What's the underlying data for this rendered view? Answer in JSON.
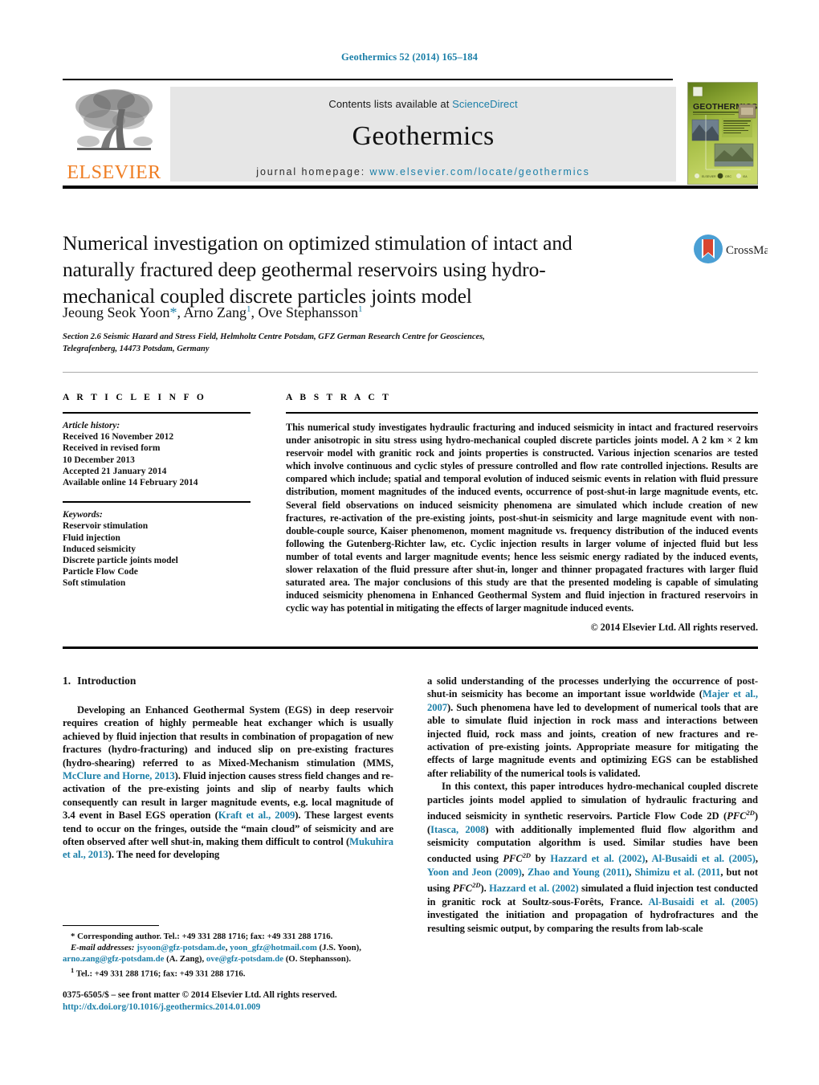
{
  "running_head": "Geothermics 52 (2014) 165–184",
  "masthead": {
    "contents_prefix": "Contents lists available at ",
    "contents_link": "ScienceDirect",
    "journal_name": "Geothermics",
    "homepage_label": "journal homepage:",
    "homepage_url": "www.elsevier.com/locate/geothermics",
    "publisher": "ELSEVIER",
    "cover_title": "GEOTHERMICS"
  },
  "article": {
    "title": "Numerical investigation on optimized stimulation of intact and naturally fractured deep geothermal reservoirs using hydro-mechanical coupled discrete particles joints model",
    "authors_plain": "Jeoung Seok Yoon*, Arno Zang 1, Ove Stephansson 1",
    "author_1": "Jeoung Seok Yoon",
    "author_2": "Arno Zang",
    "author_3": "Ove Stephansson",
    "affiliation_line_1": "Section 2.6 Seismic Hazard and Stress Field, Helmholtz Centre Potsdam, GFZ German Research Centre for Geosciences,",
    "affiliation_line_2": "Telegrafenberg, 14473 Potsdam, Germany",
    "crossmark_label": "CrossMark"
  },
  "article_info": {
    "heading": "A R T I C L E   I N F O",
    "history_label": "Article history:",
    "history": [
      "Received 16 November 2012",
      "Received in revised form",
      "10 December 2013",
      "Accepted 21 January 2014",
      "Available online 14 February 2014"
    ],
    "keywords_label": "Keywords:",
    "keywords": [
      "Reservoir stimulation",
      "Fluid injection",
      "Induced seismicity",
      "Discrete particle joints model",
      "Particle Flow Code",
      "Soft stimulation"
    ]
  },
  "abstract": {
    "heading": "A B S T R A C T",
    "text": "This numerical study investigates hydraulic fracturing and induced seismicity in intact and fractured reservoirs under anisotropic in situ stress using hydro-mechanical coupled discrete particles joints model. A 2 km × 2 km reservoir model with granitic rock and joints properties is constructed. Various injection scenarios are tested which involve continuous and cyclic styles of pressure controlled and flow rate controlled injections. Results are compared which include; spatial and temporal evolution of induced seismic events in relation with fluid pressure distribution, moment magnitudes of the induced events, occurrence of post-shut-in large magnitude events, etc. Several field observations on induced seismicity phenomena are simulated which include creation of new fractures, re-activation of the pre-existing joints, post-shut-in seismicity and large magnitude event with non-double-couple source, Kaiser phenomenon, moment magnitude vs. frequency distribution of the induced events following the Gutenberg-Richter law, etc. Cyclic injection results in larger volume of injected fluid but less number of total events and larger magnitude events; hence less seismic energy radiated by the induced events, slower relaxation of the fluid pressure after shut-in, longer and thinner propagated fractures with larger fluid saturated area. The major conclusions of this study are that the presented modeling is capable of simulating induced seismicity phenomena in Enhanced Geothermal System and fluid injection in fractured reservoirs in cyclic way has potential in mitigating the effects of larger magnitude induced events.",
    "copyright": "© 2014 Elsevier Ltd. All rights reserved."
  },
  "introduction": {
    "number": "1.",
    "heading": "Introduction",
    "left_p1_a": "Developing an Enhanced Geothermal System (EGS) in deep reservoir requires creation of highly permeable heat exchanger which is usually achieved by fluid injection that results in combination of propagation of new fractures (hydro-fracturing) and induced slip on pre-existing fractures (hydro-shearing) referred to as Mixed-Mechanism stimulation (MMS, ",
    "left_cite_1": "McClure and Horne, 2013",
    "left_p1_b": "). Fluid injection causes stress field changes and re-activation of the pre-existing joints and slip of nearby faults which consequently can result in larger magnitude events, e.g. local magnitude of 3.4 event in Basel EGS operation (",
    "left_cite_2": "Kraft et al., 2009",
    "left_p1_c": "). These largest events tend to occur on the fringes, outside the “main cloud” of seismicity and are often observed after well shut-in, making them difficult to control (",
    "left_cite_3": "Mukuhira et al., 2013",
    "left_p1_d": "). The need for developing",
    "right_p1_a": "a solid understanding of the processes underlying the occurrence of post-shut-in seismicity has become an important issue worldwide (",
    "right_cite_1": "Majer et al., 2007",
    "right_p1_b": "). Such phenomena have led to development of numerical tools that are able to simulate fluid injection in rock mass and interactions between injected fluid, rock mass and joints, creation of new fractures and re-activation of pre-existing joints. Appropriate measure for mitigating the effects of large magnitude events and optimizing EGS can be established after reliability of the numerical tools is validated.",
    "right_p2_a": "In this context, this paper introduces hydro-mechanical coupled discrete particles joints model applied to simulation of hydraulic fracturing and induced seismicity in synthetic reservoirs. Particle Flow Code 2D (",
    "right_pfc_italic": "PFC",
    "right_pfc_sup": "2D",
    "right_p2_b": ") (",
    "right_cite_2": "Itasca, 2008",
    "right_p2_c": ") with additionally implemented fluid flow algorithm and seismicity computation algorithm is used. Similar studies have been conducted using ",
    "right_p2_d": " by ",
    "right_cite_3": "Hazzard et al. (2002)",
    "right_p2_e": ", ",
    "right_cite_4": "Al-Busaidi et al. (2005)",
    "right_cite_5": "Yoon and Jeon (2009)",
    "right_cite_6": "Zhao and Young (2011)",
    "right_cite_7": "Shimizu et al. (2011",
    "right_p2_f": ", but not using ",
    "right_p2_g": ").",
    "right_cite_8": "Hazzard et al. (2002)",
    "right_p2_h": " simulated a fluid injection test conducted in granitic rock at Soultz-sous-Forêts, France. ",
    "right_cite_9": "Al-Busaidi et al. (2005)",
    "right_p2_i": " investigated the initiation and propagation of hydrofractures and the resulting seismic output, by comparing the results from lab-scale"
  },
  "footnotes": {
    "corresponding": "* Corresponding author. Tel.: +49 331 288 1716; fax: +49 331 288 1716.",
    "email_label": "E-mail addresses:",
    "email_1": "jsyoon@gfz-potsdam.de",
    "email_2": "yoon_gfz@hotmail.com",
    "email_1_owner": " (J.S. Yoon),",
    "email_3": "arno.zang@gfz-potsdam.de",
    "email_3_owner": " (A. Zang), ",
    "email_4": "ove@gfz-potsdam.de",
    "email_4_owner": " (O. Stephansson).",
    "tel_note": "Tel.: +49 331 288 1716; fax: +49 331 288 1716.",
    "tel_sup": "1"
  },
  "footer": {
    "front_matter": "0375-6505/$ – see front matter © 2014 Elsevier Ltd. All rights reserved.",
    "doi": "http://dx.doi.org/10.1016/j.geothermics.2014.01.009"
  },
  "colors": {
    "link": "#1b7fa8",
    "elsevier_orange": "#ef7d22",
    "panel_grey": "#e6e6e6"
  }
}
